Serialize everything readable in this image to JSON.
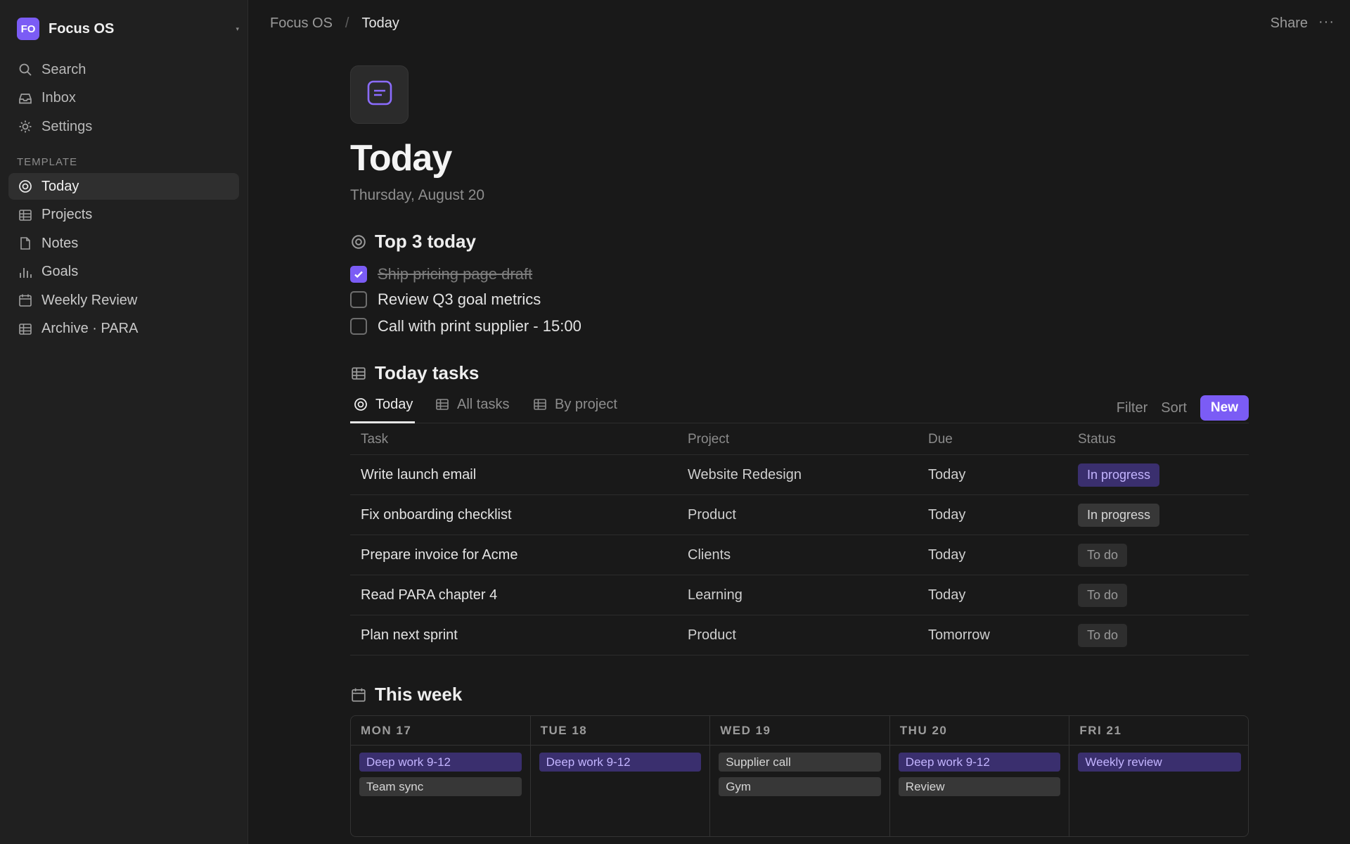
{
  "colors": {
    "accent": "#7b5cf5",
    "purple_chip_bg": "#3a2f6e",
    "purple_chip_text": "#c3b4ff",
    "gray_chip_bg": "#373737",
    "gray_chip_text": "#d6d6d6"
  },
  "workspace": {
    "badge": "FO",
    "name": "Focus OS",
    "caret": "▾"
  },
  "sidebar": {
    "top_items": [
      {
        "label": "Search",
        "icon": "search-icon"
      },
      {
        "label": "Inbox",
        "icon": "inbox-icon"
      },
      {
        "label": "Settings",
        "icon": "gear-icon"
      }
    ],
    "section_label": "TEMPLATE",
    "items": [
      {
        "label": "Today",
        "icon": "target-icon",
        "active": true
      },
      {
        "label": "Projects",
        "icon": "table-icon"
      },
      {
        "label": "Notes",
        "icon": "document-icon"
      },
      {
        "label": "Goals",
        "icon": "bar-chart-icon"
      },
      {
        "label": "Weekly Review",
        "icon": "calendar-icon"
      },
      {
        "label": "Archive · PARA",
        "icon": "table-icon"
      }
    ]
  },
  "topbar": {
    "breadcrumb": [
      "Focus OS",
      "Today"
    ],
    "separator": "/",
    "share": "Share",
    "more": "···"
  },
  "page": {
    "icon": "note-icon",
    "title": "Today",
    "date": "Thursday, August 20"
  },
  "top3": {
    "heading": "Top 3 today",
    "items": [
      {
        "text": "Ship pricing page draft",
        "checked": true
      },
      {
        "text": "Review Q3 goal metrics",
        "checked": false
      },
      {
        "text": "Call with print supplier - 15:00",
        "checked": false
      }
    ]
  },
  "tasks": {
    "heading": "Today tasks",
    "tabs": [
      {
        "label": "Today",
        "icon": "target-icon",
        "active": true
      },
      {
        "label": "All tasks",
        "icon": "table-icon"
      },
      {
        "label": "By project",
        "icon": "table-icon"
      }
    ],
    "tools": {
      "filter": "Filter",
      "sort": "Sort",
      "new": "New"
    },
    "columns": [
      "Task",
      "Project",
      "Due",
      "Status"
    ],
    "rows": [
      {
        "task": "Write launch email",
        "project": "Website Redesign",
        "due": "Today",
        "status": "In progress",
        "status_style": "purple"
      },
      {
        "task": "Fix onboarding checklist",
        "project": "Product",
        "due": "Today",
        "status": "In progress",
        "status_style": "gray"
      },
      {
        "task": "Prepare invoice for Acme",
        "project": "Clients",
        "due": "Today",
        "status": "To do",
        "status_style": "dim"
      },
      {
        "task": "Read PARA chapter 4",
        "project": "Learning",
        "due": "Today",
        "status": "To do",
        "status_style": "dim"
      },
      {
        "task": "Plan next sprint",
        "project": "Product",
        "due": "Tomorrow",
        "status": "To do",
        "status_style": "dim"
      }
    ]
  },
  "week": {
    "heading": "This week",
    "days": [
      {
        "label": "MON 17",
        "events": [
          {
            "text": "Deep work 9-12",
            "style": "purple"
          },
          {
            "text": "Team sync",
            "style": "gray"
          }
        ]
      },
      {
        "label": "TUE 18",
        "events": [
          {
            "text": "Deep work 9-12",
            "style": "purple"
          }
        ]
      },
      {
        "label": "WED 19",
        "events": [
          {
            "text": "Supplier call",
            "style": "gray"
          },
          {
            "text": "Gym",
            "style": "gray"
          }
        ]
      },
      {
        "label": "THU 20",
        "events": [
          {
            "text": "Deep work 9-12",
            "style": "purple"
          },
          {
            "text": "Review",
            "style": "gray"
          }
        ]
      },
      {
        "label": "FRI 21",
        "events": [
          {
            "text": "Weekly review",
            "style": "purple"
          }
        ]
      }
    ]
  }
}
